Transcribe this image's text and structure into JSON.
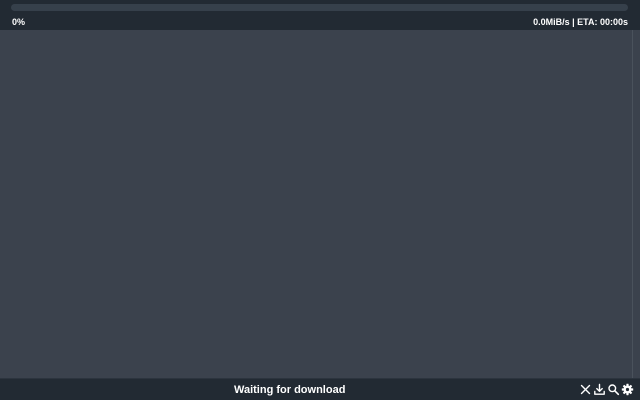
{
  "header": {
    "progress_fraction": 0,
    "progress_text": "0%",
    "speed_eta_text": "0.0MiB/s | ETA: 00:00s"
  },
  "footer": {
    "status_text": "Waiting for download",
    "icons": [
      "close-icon",
      "download-icon",
      "search-icon",
      "gear-icon"
    ]
  },
  "colors": {
    "background": "#3b424d",
    "panel": "#222a33",
    "progress_track": "#36404b",
    "text": "#ffffff"
  }
}
